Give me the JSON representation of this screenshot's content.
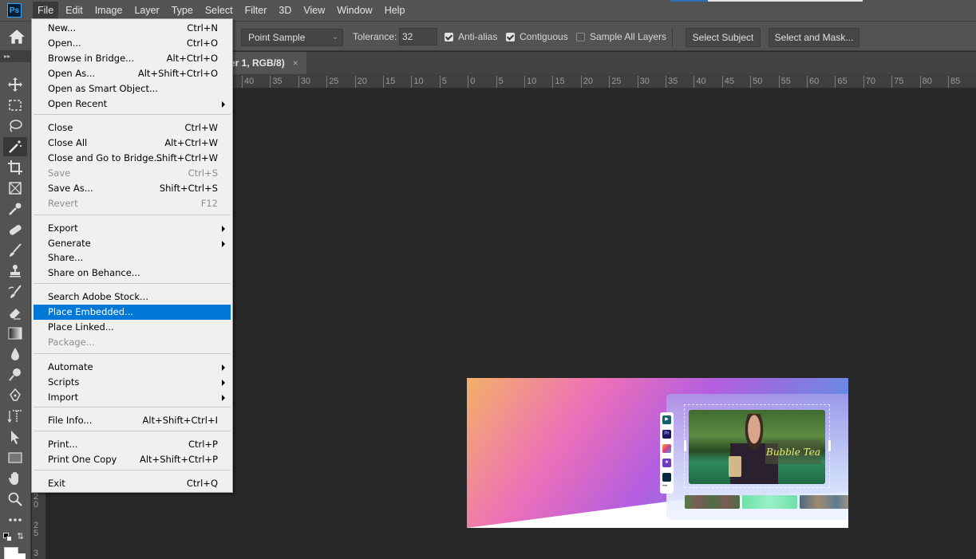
{
  "app": {
    "logo": "Ps",
    "menubar": [
      "File",
      "Edit",
      "Image",
      "Layer",
      "Type",
      "Select",
      "Filter",
      "3D",
      "View",
      "Window",
      "Help"
    ],
    "active_menu": "File"
  },
  "options_bar": {
    "sample_size_value": "Point Sample",
    "tolerance_label": "Tolerance:",
    "tolerance_value": "32",
    "anti_alias_label": "Anti-alias",
    "anti_alias_checked": true,
    "contiguous_label": "Contiguous",
    "contiguous_checked": true,
    "sample_all_layers_label": "Sample All Layers",
    "sample_all_layers_checked": false,
    "select_subject_label": "Select Subject",
    "select_and_mask_label": "Select and Mask..."
  },
  "document": {
    "tab_title": "er 1, RGB/8)",
    "close_glyph": "×"
  },
  "rulers": {
    "horizontal": [
      "40",
      "35",
      "30",
      "25",
      "20",
      "15",
      "10",
      "5",
      "0",
      "5",
      "10",
      "15",
      "20",
      "25",
      "30",
      "35",
      "40",
      "45",
      "50",
      "55",
      "60",
      "65",
      "70",
      "75",
      "80",
      "85"
    ],
    "vertical": [
      "2 0",
      "2 5",
      "3"
    ]
  },
  "toolbar": {
    "tools": [
      "move-tool",
      "marquee-tool",
      "lasso-tool",
      "magic-wand-tool",
      "crop-tool",
      "frame-tool",
      "eyedropper-tool",
      "healing-brush-tool",
      "brush-tool",
      "clone-stamp-tool",
      "history-brush-tool",
      "eraser-tool",
      "gradient-tool",
      "blur-tool",
      "dodge-tool",
      "pen-tool",
      "type-tool",
      "path-selection-tool",
      "rectangle-tool",
      "hand-tool",
      "zoom-tool",
      "more-tools"
    ],
    "active_tool": "magic-wand-tool"
  },
  "file_menu": {
    "items": [
      {
        "label": "New...",
        "shortcut": "Ctrl+N"
      },
      {
        "label": "Open...",
        "shortcut": "Ctrl+O"
      },
      {
        "label": "Browse in Bridge...",
        "shortcut": "Alt+Ctrl+O"
      },
      {
        "label": "Open As...",
        "shortcut": "Alt+Shift+Ctrl+O"
      },
      {
        "label": "Open as Smart Object...",
        "shortcut": ""
      },
      {
        "label": "Open Recent",
        "shortcut": "",
        "submenu": true
      },
      {
        "label": "Close",
        "shortcut": "Ctrl+W"
      },
      {
        "label": "Close All",
        "shortcut": "Alt+Ctrl+W"
      },
      {
        "label": "Close and Go to Bridge...",
        "shortcut": "Shift+Ctrl+W"
      },
      {
        "label": "Save",
        "shortcut": "Ctrl+S",
        "disabled": true
      },
      {
        "label": "Save As...",
        "shortcut": "Shift+Ctrl+S"
      },
      {
        "label": "Revert",
        "shortcut": "F12",
        "disabled": true
      },
      {
        "label": "Export",
        "shortcut": "",
        "submenu": true
      },
      {
        "label": "Generate",
        "shortcut": "",
        "submenu": true
      },
      {
        "label": "Share...",
        "shortcut": ""
      },
      {
        "label": "Share on Behance...",
        "shortcut": ""
      },
      {
        "label": "Search Adobe Stock...",
        "shortcut": ""
      },
      {
        "label": "Place Embedded...",
        "shortcut": "",
        "highlighted": true
      },
      {
        "label": "Place Linked...",
        "shortcut": ""
      },
      {
        "label": "Package...",
        "shortcut": "",
        "disabled": true
      },
      {
        "label": "Automate",
        "shortcut": "",
        "submenu": true
      },
      {
        "label": "Scripts",
        "shortcut": "",
        "submenu": true
      },
      {
        "label": "Import",
        "shortcut": "",
        "submenu": true
      },
      {
        "label": "File Info...",
        "shortcut": "Alt+Shift+Ctrl+I"
      },
      {
        "label": "Print...",
        "shortcut": "Ctrl+P"
      },
      {
        "label": "Print One Copy",
        "shortcut": "Alt+Shift+Ctrl+P"
      },
      {
        "label": "Exit",
        "shortcut": "Ctrl+Q"
      }
    ]
  },
  "artwork": {
    "caption_text": "Bubble Tea",
    "app_icons": [
      "filmora",
      "Pr",
      "final-cut",
      "imovie",
      "other-editor"
    ],
    "more_glyph": "•••"
  },
  "colors": {
    "highlight": "#0078d7",
    "menubar_bg": "#535353",
    "canvas_bg": "#282828"
  }
}
